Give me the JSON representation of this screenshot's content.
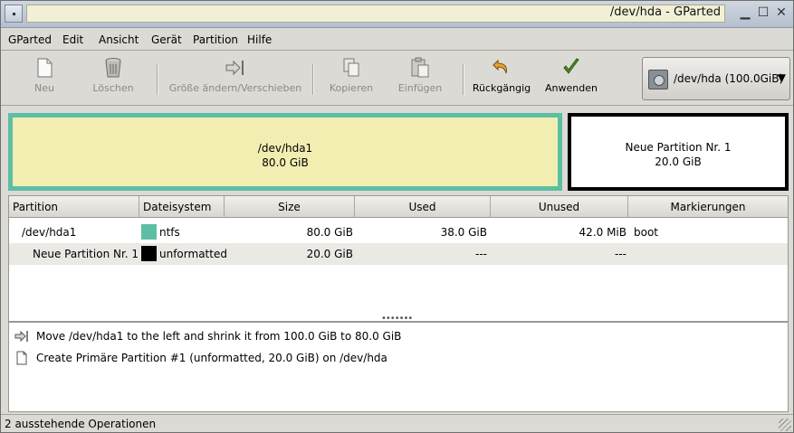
{
  "window": {
    "title": "/dev/hda - GParted"
  },
  "menubar": {
    "items": [
      "GParted",
      "Edit",
      "Ansicht",
      "Gerät",
      "Partition",
      "Hilfe"
    ]
  },
  "toolbar": {
    "new_label": "Neu",
    "delete_label": "Löschen",
    "resize_label": "Größe ändern/Verschieben",
    "copy_label": "Kopieren",
    "paste_label": "Einfügen",
    "undo_label": "Rückgängig",
    "apply_label": "Anwenden",
    "device_select": "/dev/hda (100.0GiB)"
  },
  "graph": {
    "partitions": [
      {
        "name": "/dev/hda1",
        "size": "80.0 GiB",
        "color": "#5cbfa3"
      },
      {
        "name": "Neue Partition Nr. 1",
        "size": "20.0 GiB",
        "color": "#000000"
      }
    ]
  },
  "table": {
    "headers": [
      "Partition",
      "Dateisystem",
      "Size",
      "Used",
      "Unused",
      "Markierungen"
    ],
    "rows": [
      {
        "partition": "/dev/hda1",
        "filesystem": "ntfs",
        "fs_color": "#5cbfa3",
        "size": "80.0 GiB",
        "used": "38.0 GiB",
        "unused": "42.0 MiB",
        "flags": "boot"
      },
      {
        "partition": "Neue Partition Nr. 1",
        "filesystem": "unformatted",
        "fs_color": "#000000",
        "size": "20.0 GiB",
        "used": "---",
        "unused": "---",
        "flags": ""
      }
    ]
  },
  "operations": [
    {
      "icon": "resize-move-icon",
      "text": "Move /dev/hda1 to the left and shrink it from 100.0 GiB to 80.0 GiB"
    },
    {
      "icon": "new-partition-icon",
      "text": "Create Primäre Partition #1 (unformatted, 20.0 GiB) on /dev/hda"
    }
  ],
  "status": {
    "text": "2 ausstehende Operationen"
  }
}
